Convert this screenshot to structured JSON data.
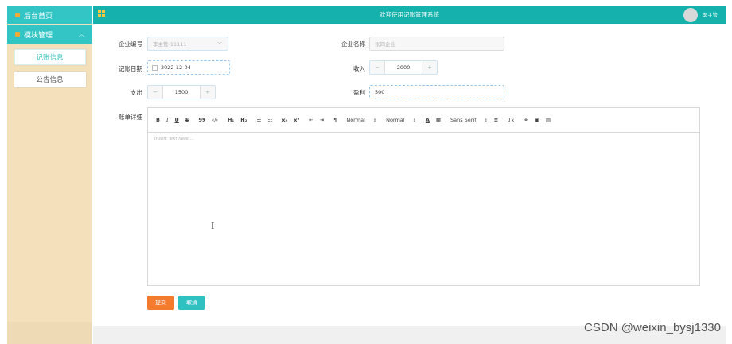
{
  "sidebar": {
    "home_label": "后台首页",
    "group_label": "模块管理",
    "items": [
      {
        "label": "记账信息"
      },
      {
        "label": "公告信息"
      }
    ]
  },
  "header": {
    "title": "欢迎使用记账管理系统",
    "username": "李主管"
  },
  "form": {
    "company_id_label": "企业编号",
    "company_id_value": "李主管-11111",
    "company_name_label": "企业名称",
    "company_name_value": "张四企业",
    "date_label": "记账日期",
    "date_value": "2022-12-04",
    "income_label": "收入",
    "income_value": "2000",
    "expense_label": "支出",
    "expense_value": "1500",
    "profit_label": "盈利",
    "profit_value": "500",
    "detail_label": "账单详细"
  },
  "editor": {
    "toolbar": {
      "bold": "B",
      "italic": "I",
      "underline": "U",
      "strike": "S",
      "quote": "99",
      "code": "‹/›",
      "h1": "H₁",
      "h2": "H₂",
      "ordered_list": "☰",
      "bullet_list": "☷",
      "subscript": "x₂",
      "superscript": "x²",
      "indent_left": "⇤",
      "indent_right": "⇥",
      "rtl": "¶",
      "size_select": "Normal",
      "header_select": "Normal",
      "font_select": "Sans Serif",
      "color": "A",
      "background": "▩",
      "align": "≡",
      "clean": "Tx",
      "link": "🔗",
      "image": "▣",
      "video": "▤"
    },
    "placeholder": "Insert text here ..."
  },
  "buttons": {
    "submit": "提交",
    "cancel": "取消"
  },
  "watermark": "CSDN @weixin_bysj1330",
  "colors": {
    "header": "#14b1ad",
    "sidebar_bg": "#f5e0bc",
    "sidebar_active": "#33c5c5",
    "submit": "#f47a2d",
    "cancel": "#2fc1c1"
  }
}
